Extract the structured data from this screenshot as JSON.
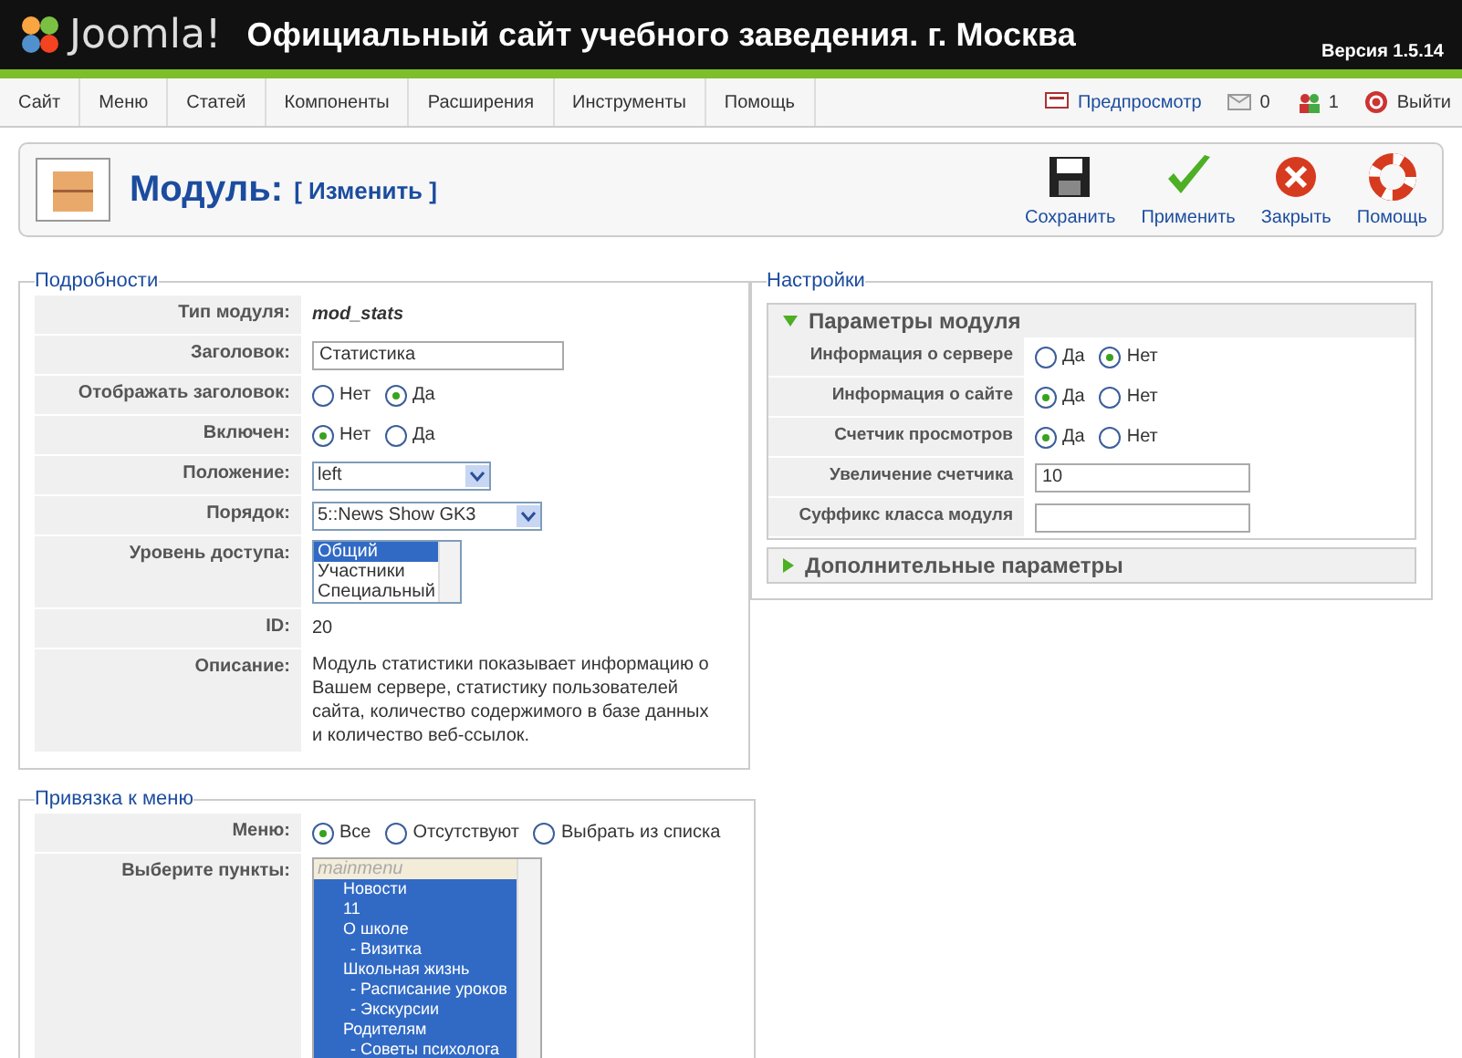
{
  "header": {
    "logo": "Joomla!",
    "site_title": "Официальный сайт учебного заведения. г. Москва",
    "version": "Версия 1.5.14"
  },
  "menu_bar": {
    "items": [
      {
        "label": "Сайт"
      },
      {
        "label": "Меню"
      },
      {
        "label": "Статей"
      },
      {
        "label": "Компоненты"
      },
      {
        "label": "Расширения"
      },
      {
        "label": "Инструменты"
      },
      {
        "label": "Помощь"
      }
    ],
    "status": [
      {
        "kind": "preview",
        "label": "Предпросмотр"
      },
      {
        "kind": "messages",
        "label": "0"
      },
      {
        "kind": "users",
        "label": "1"
      },
      {
        "kind": "logout",
        "label": "Выйти"
      }
    ]
  },
  "toolbar": {
    "title": "Модуль:",
    "subtitle": "[ Изменить ]",
    "buttons": [
      {
        "kind": "save",
        "label": "Сохранить"
      },
      {
        "kind": "apply",
        "label": "Применить"
      },
      {
        "kind": "close",
        "label": "Закрыть"
      },
      {
        "kind": "help",
        "label": "Помощь"
      }
    ]
  },
  "details": {
    "legend": "Подробности",
    "rows": [
      {
        "kind": "text",
        "label": "Тип модуля:",
        "value": "mod_stats",
        "italic": true
      },
      {
        "kind": "input",
        "label": "Заголовок:",
        "value": "Статистика"
      },
      {
        "kind": "radio",
        "label": "Отображать заголовок:",
        "options": [
          {
            "label": "Нет",
            "selected": false
          },
          {
            "label": "Да",
            "selected": true
          }
        ]
      },
      {
        "kind": "radio",
        "label": "Включен:",
        "options": [
          {
            "label": "Нет",
            "selected": true
          },
          {
            "label": "Да",
            "selected": false
          }
        ]
      },
      {
        "kind": "select",
        "label": "Положение:",
        "value": "left",
        "wide": false
      },
      {
        "kind": "select",
        "label": "Порядок:",
        "value": "5::News Show GK3",
        "wide": true
      },
      {
        "kind": "listbox",
        "label": "Уровень доступа:",
        "options": [
          {
            "label": "Общий",
            "selected": true
          },
          {
            "label": "Участники",
            "selected": false
          },
          {
            "label": "Специальный",
            "selected": false
          }
        ]
      },
      {
        "kind": "text",
        "label": "ID:",
        "value": "20",
        "italic": false
      },
      {
        "kind": "text",
        "label": "Описание:",
        "value": "Модуль статистики показывает информацию о Вашем сервере, статистику пользователей сайта, количество содержимого в базе данных и количество веб-ссылок.",
        "italic": false
      }
    ]
  },
  "menu_assignment": {
    "legend": "Привязка к меню",
    "menus_label": "Меню:",
    "menus": [
      {
        "label": "Все",
        "selected": true
      },
      {
        "label": "Отсутствуют",
        "selected": false
      },
      {
        "label": "Выбрать из списка",
        "selected": false
      }
    ],
    "items_label": "Выберите пункты:",
    "group": "mainmenu",
    "items": [
      {
        "label": "Новости",
        "selected": true
      },
      {
        "label": "11",
        "selected": true
      },
      {
        "label": "О школе",
        "selected": true,
        "children": [
          {
            "label": "- Визитка",
            "selected": true
          }
        ]
      },
      {
        "label": "Школьная жизнь",
        "selected": true,
        "children": [
          {
            "label": "- Расписание уроков",
            "selected": true
          },
          {
            "label": "- Экскурсии",
            "selected": true
          }
        ]
      },
      {
        "label": "Родителям",
        "selected": true,
        "children": [
          {
            "label": "- Советы психолога",
            "selected": true
          }
        ]
      }
    ]
  },
  "settings": {
    "legend": "Настройки",
    "sections": [
      {
        "title": "Параметры модуля",
        "expanded": true,
        "rows": [
          {
            "kind": "radio",
            "label": "Информация о сервере",
            "options": [
              {
                "label": "Да",
                "selected": false
              },
              {
                "label": "Нет",
                "selected": true
              }
            ]
          },
          {
            "kind": "radio",
            "label": "Информация о сайте",
            "options": [
              {
                "label": "Да",
                "selected": true
              },
              {
                "label": "Нет",
                "selected": false
              }
            ]
          },
          {
            "kind": "radio",
            "label": "Счетчик просмотров",
            "options": [
              {
                "label": "Да",
                "selected": true
              },
              {
                "label": "Нет",
                "selected": false
              }
            ]
          },
          {
            "kind": "input",
            "label": "Увеличение счетчика",
            "value": "10"
          },
          {
            "kind": "input",
            "label": "Суффикс класса модуля"
          }
        ]
      },
      {
        "title": "Дополнительные параметры",
        "expanded": false
      }
    ]
  }
}
